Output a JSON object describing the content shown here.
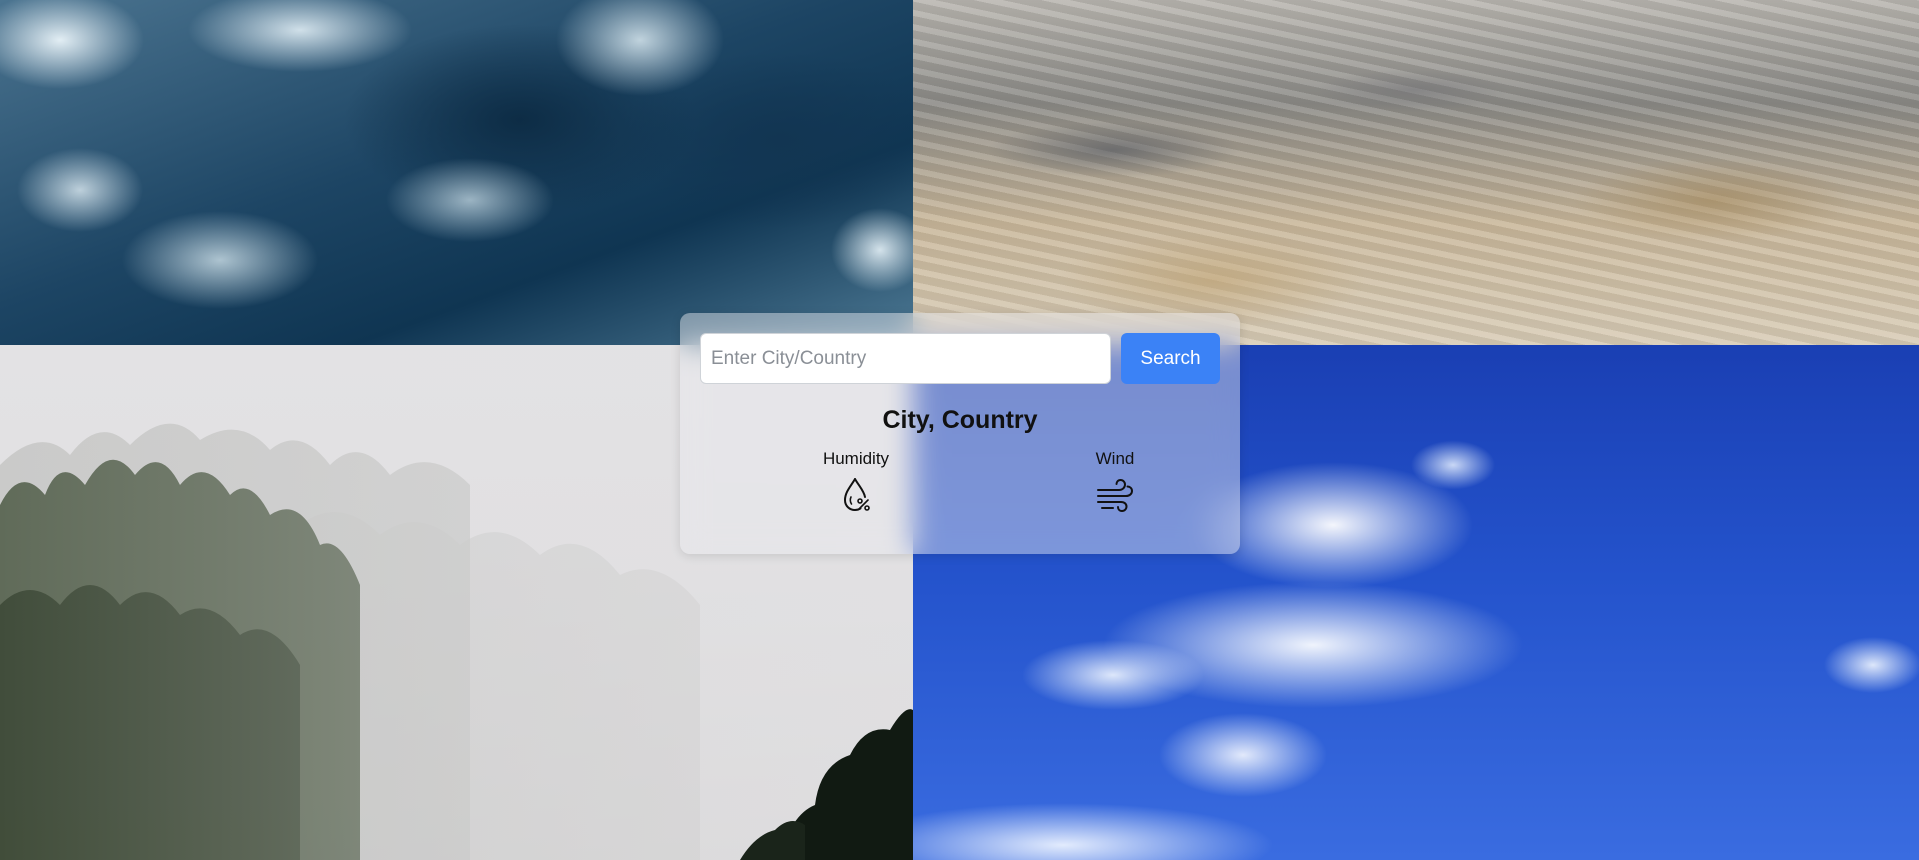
{
  "search": {
    "placeholder": "Enter City/Country",
    "value": "",
    "button_label": "Search"
  },
  "weather": {
    "location": "City, Country",
    "metrics": [
      {
        "label": "Humidity",
        "icon": "humidity-drop-percent-icon"
      },
      {
        "label": "Wind",
        "icon": "wind-icon"
      }
    ]
  },
  "background": {
    "tiles": [
      "dark-clouds",
      "rain-puddle",
      "foggy-forest",
      "blue-sky-clouds"
    ]
  },
  "colors": {
    "accent": "#3b82f6",
    "button_text": "#ffffff",
    "heading_text": "#111111"
  }
}
